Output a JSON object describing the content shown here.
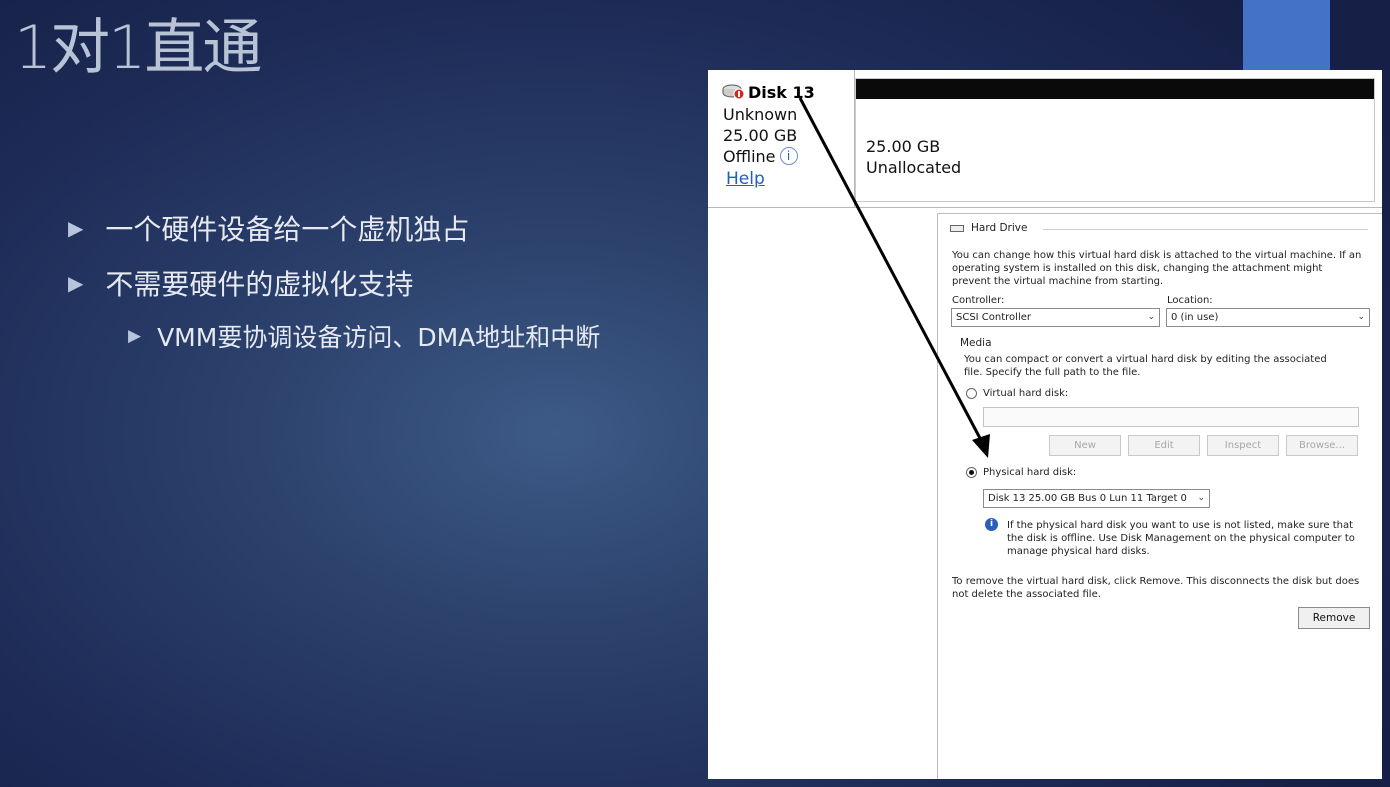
{
  "slide": {
    "title": "1对1直通",
    "bullets": [
      "一个硬件设备给一个虚机独占",
      "不需要硬件的虚拟化支持",
      "VMM要协调设备访问、DMA地址和中断"
    ],
    "bullet_marker": "▶"
  },
  "disk_management": {
    "disk_name": "Disk 13",
    "type": "Unknown",
    "size": "25.00 GB",
    "status": "Offline",
    "help_link": "Help",
    "partition_size": "25.00 GB",
    "partition_status": "Unallocated"
  },
  "hard_drive_settings": {
    "section_title": "Hard Drive",
    "intro_text": "You can change how this virtual hard disk is attached to the virtual machine. If an operating system is installed on this disk, changing the attachment might prevent the virtual machine from starting.",
    "controller_label": "Controller:",
    "controller_value": "SCSI Controller",
    "location_label": "Location:",
    "location_value": "0 (in use)",
    "media_label": "Media",
    "media_text": "You can compact or convert a virtual hard disk by editing the associated file. Specify the full path to the file.",
    "virtual_hard_disk_label": "Virtual hard disk:",
    "virtual_hard_disk_path": "",
    "buttons": {
      "new": "New",
      "edit": "Edit",
      "inspect": "Inspect",
      "browse": "Browse..."
    },
    "physical_hard_disk_label": "Physical hard disk:",
    "physical_hard_disk_value": "Disk 13 25.00 GB Bus 0 Lun 11 Target 0",
    "selected_media": "physical",
    "info_text": "If the physical hard disk you want to use is not listed, make sure that the disk is offline. Use Disk Management on the physical computer to manage physical hard disks.",
    "remove_text": "To remove the virtual hard disk, click Remove. This disconnects the disk but does not delete the associated file.",
    "remove_button": "Remove"
  },
  "colors": {
    "accent_bar": "#4472c4",
    "link": "#1f5fc4"
  }
}
